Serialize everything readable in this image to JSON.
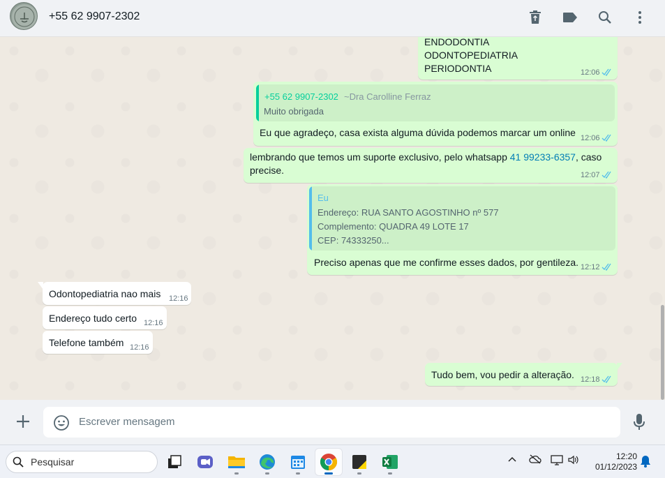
{
  "header": {
    "contact_name": "+55 62 9907-2302",
    "icons": [
      "avatar",
      "delete-icon",
      "label-icon",
      "search-icon",
      "menu-icon"
    ]
  },
  "messages": [
    {
      "dir": "out",
      "lines": [
        "ENDODONTIA",
        "ODONTOPEDIATRIA",
        "PERIODONTIA"
      ],
      "time": "12:06",
      "status": "read"
    },
    {
      "dir": "out",
      "quote": {
        "author": "+55 62 9907-2302",
        "author_name": "~Dra Carolline Ferraz",
        "text": "Muito obrigada"
      },
      "text": "Eu que agradeço, casa exista alguma dúvida podemos marcar um online",
      "time": "12:06",
      "status": "read"
    },
    {
      "dir": "out",
      "text_before": "lembrando que temos um suporte exclusivo, pelo whatsapp ",
      "link": "41 99233-6357",
      "text_after": ", caso",
      "text_line2": "precise.",
      "time": "12:07",
      "status": "read"
    },
    {
      "dir": "out",
      "quote": {
        "author": "Eu",
        "lines": [
          "Endereço: RUA SANTO AGOSTINHO nº 577",
          "Complemento: QUADRA 49 LOTE 17",
          "CEP: 74333250..."
        ]
      },
      "text": "Preciso apenas que me confirme esses dados, por gentileza.",
      "time": "12:12",
      "status": "read"
    },
    {
      "dir": "in",
      "text": "Odontopediatria nao mais",
      "time": "12:16"
    },
    {
      "dir": "in",
      "text": "Endereço tudo certo",
      "time": "12:16"
    },
    {
      "dir": "in",
      "text": "Telefone também",
      "time": "12:16"
    },
    {
      "dir": "out",
      "text": "Tudo bem, vou pedir a alteração.",
      "time": "12:18",
      "status": "read"
    }
  ],
  "composer": {
    "placeholder": "Escrever mensagem",
    "icons": [
      "plus-icon",
      "emoji-icon",
      "mic-icon"
    ]
  },
  "taskbar": {
    "search_placeholder": "Pesquisar",
    "apps": [
      "task-view",
      "teams",
      "file-explorer",
      "edge",
      "calendar",
      "chrome",
      "sticky-notes",
      "excel"
    ],
    "active_app": "chrome",
    "time": "12:20",
    "date": "01/12/2023"
  },
  "colors": {
    "outgoing_bubble": "#d9fdd3",
    "incoming_bubble": "#ffffff",
    "chat_background": "#efeae2",
    "read_ticks": "#53bdeb",
    "quote_author_green": "#06cf9c",
    "quote_author_blue": "#53bdeb",
    "link": "#027eb5"
  }
}
